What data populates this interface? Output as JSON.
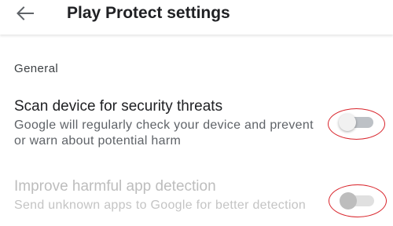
{
  "appbar": {
    "title": "Play Protect settings",
    "back_icon": "arrow-back-icon"
  },
  "section": {
    "header": "General"
  },
  "settings": [
    {
      "title": "Scan device for security threats",
      "description": "Google will regularly check your device and prevent or warn about potential harm",
      "enabled": true,
      "toggle_on": false
    },
    {
      "title": "Improve harmful app detection",
      "description": "Send unknown apps to Google for better detection",
      "enabled": false,
      "toggle_on": false
    }
  ],
  "colors": {
    "annotation": "#d9242b",
    "title_text": "#202124",
    "disabled_text": "#bdbdbd"
  }
}
